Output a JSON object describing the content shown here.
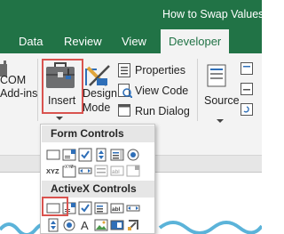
{
  "window": {
    "title": "How to Swap Values"
  },
  "tabs": [
    "Data",
    "Review",
    "View",
    "Developer"
  ],
  "active_tab": "Developer",
  "ribbon": {
    "com_addins": [
      "COM",
      "Add-ins"
    ],
    "insert": "Insert",
    "design_mode": [
      "Design",
      "Mode"
    ],
    "properties": "Properties",
    "view_code": "View Code",
    "run_dialog": "Run Dialog",
    "source": "Source"
  },
  "insert_menu": {
    "form_controls": "Form Controls",
    "activex_controls": "ActiveX Controls",
    "form_control_icons": [
      "button-icon",
      "combo-box-icon",
      "check-box-icon",
      "spin-button-icon",
      "list-box-icon",
      "option-button-icon",
      "label-icon",
      "group-box-icon",
      "scroll-bar-icon",
      "text-field-icon",
      "combo-list-edit-icon",
      "combo-drop-down-icon"
    ],
    "activex_control_icons": [
      "command-button-icon",
      "combo-box-icon",
      "check-box-icon",
      "list-box-icon",
      "text-box-icon",
      "spin-button-icon",
      "option-button-icon",
      "label-icon",
      "image-icon",
      "toggle-button-icon",
      "more-controls-icon"
    ],
    "label_glyph": "A",
    "text_glyph": "abl",
    "label_glyph_small": "XYZ"
  },
  "colors": {
    "excel_green": "#217346",
    "highlight": "#d9534f",
    "ribbon_bg": "#f3f3f3"
  }
}
